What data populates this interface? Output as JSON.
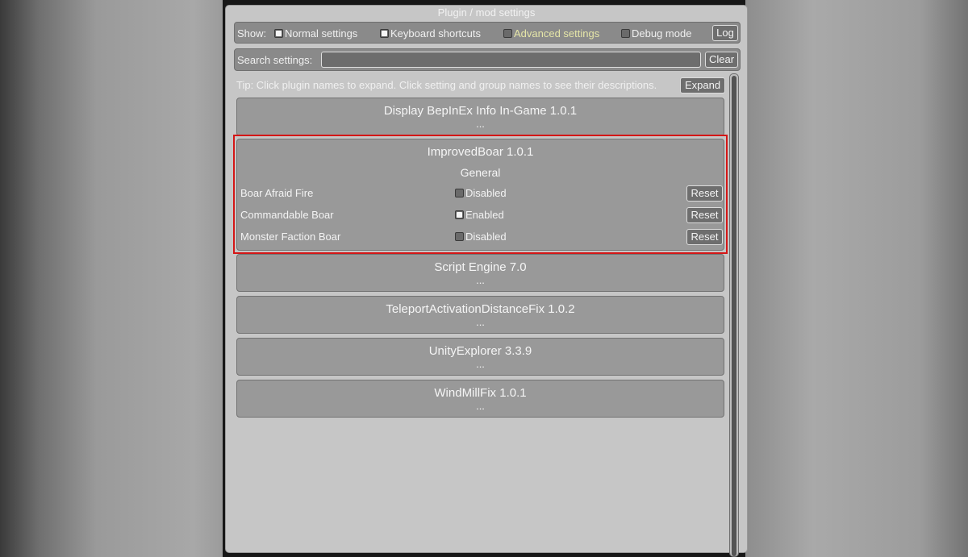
{
  "window_title": "Plugin / mod settings",
  "show_row": {
    "label": "Show:",
    "options": [
      {
        "label": "Normal settings",
        "checked": true
      },
      {
        "label": "Keyboard shortcuts",
        "checked": true
      },
      {
        "label": "Advanced settings",
        "checked": false
      },
      {
        "label": "Debug mode",
        "checked": false
      }
    ],
    "log_button": "Log"
  },
  "search": {
    "label": "Search settings:",
    "value": "",
    "clear_button": "Clear"
  },
  "tip": "Tip: Click plugin names to expand. Click setting and group names to see their descriptions.",
  "expand_button": "Expand",
  "plugins": [
    {
      "name": "Display BepInEx Info In-Game 1.0.1",
      "collapsed_text": "..."
    },
    {
      "name": "ImprovedBoar 1.0.1",
      "group": "General",
      "settings": [
        {
          "name": "Boar Afraid Fire",
          "value": "Disabled",
          "checked": false,
          "reset": "Reset"
        },
        {
          "name": "Commandable Boar",
          "value": "Enabled",
          "checked": true,
          "reset": "Reset"
        },
        {
          "name": "Monster Faction Boar",
          "value": "Disabled",
          "checked": false,
          "reset": "Reset"
        }
      ]
    },
    {
      "name": "Script Engine 7.0",
      "collapsed_text": "..."
    },
    {
      "name": "TeleportActivationDistanceFix 1.0.2",
      "collapsed_text": "..."
    },
    {
      "name": "UnityExplorer 3.3.9",
      "collapsed_text": "..."
    },
    {
      "name": "WindMillFix 1.0.1",
      "collapsed_text": "..."
    }
  ],
  "colors": {
    "highlight": "#d41616",
    "advanced_text": "#e6e6a8"
  }
}
